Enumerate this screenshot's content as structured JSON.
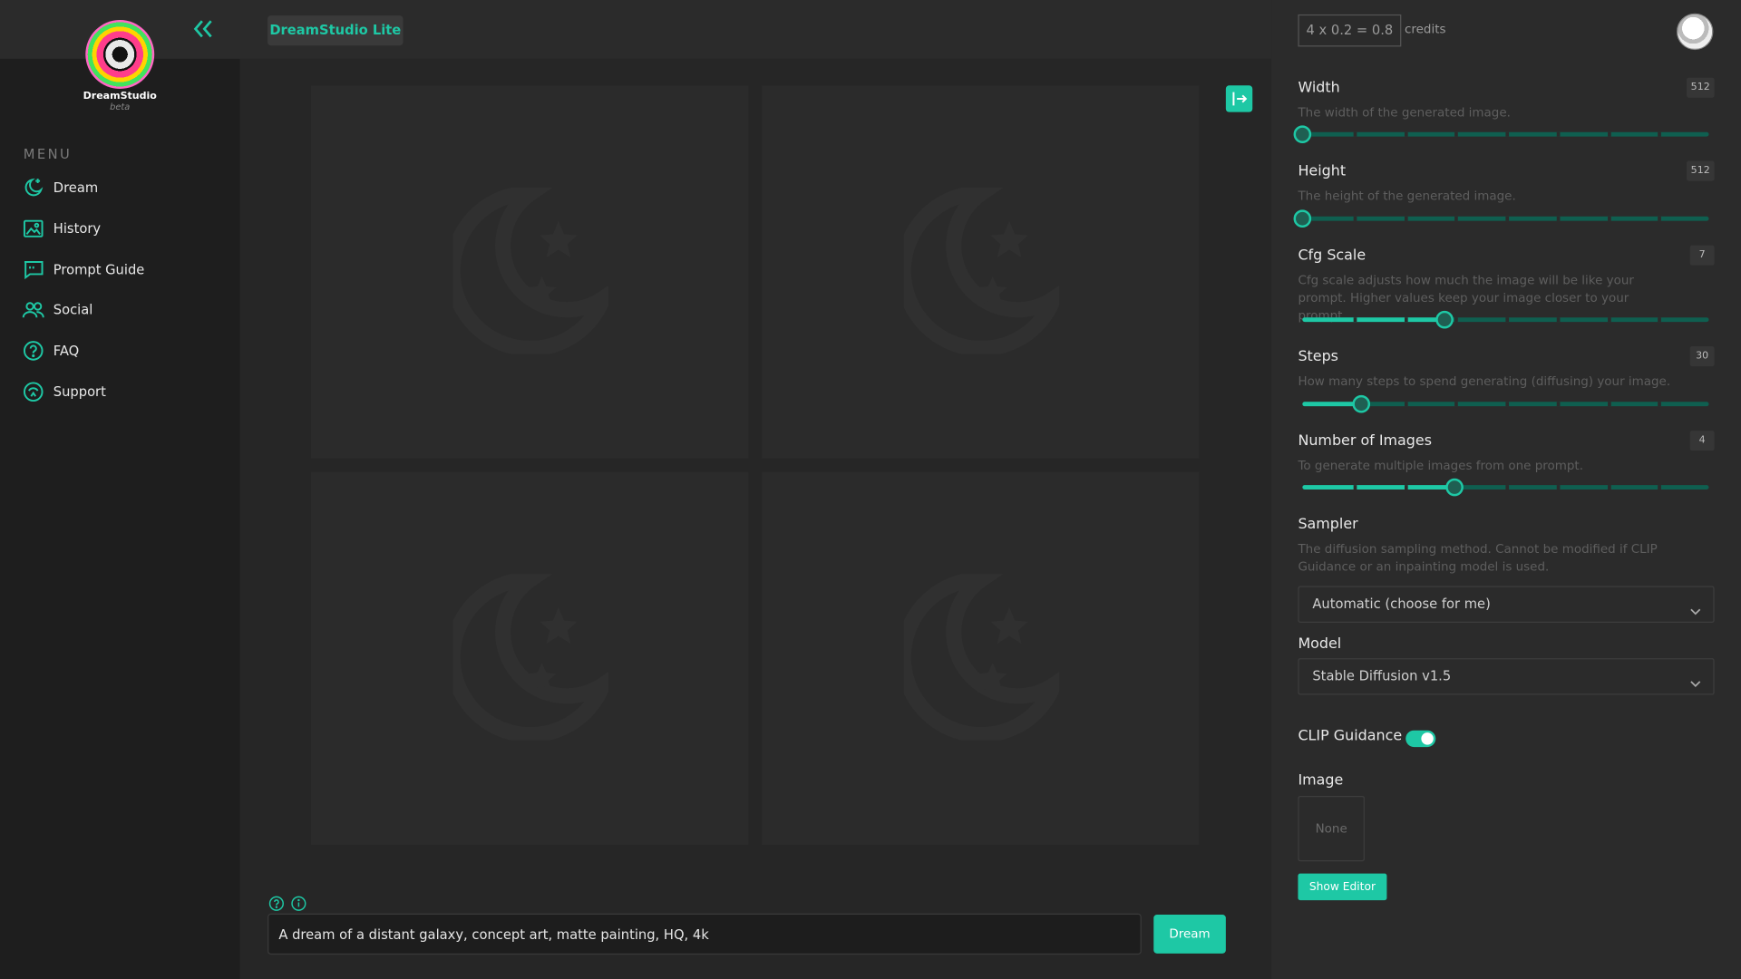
{
  "brand": {
    "app_name": "DreamStudio",
    "tag": "beta",
    "pill": "DreamStudio Lite"
  },
  "sidebar": {
    "menu_label": "MENU",
    "items": [
      {
        "label": "Dream",
        "icon": "moon-stars-icon"
      },
      {
        "label": "History",
        "icon": "image-icon"
      },
      {
        "label": "Prompt Guide",
        "icon": "quote-bubble-icon"
      },
      {
        "label": "Social",
        "icon": "users-icon"
      },
      {
        "label": "FAQ",
        "icon": "question-icon"
      },
      {
        "label": "Support",
        "icon": "support-icon"
      }
    ]
  },
  "prompt": {
    "value": "A dream of a distant galaxy, concept art, matte painting, HQ, 4k",
    "button": "Dream"
  },
  "credits": {
    "formula": "4 x 0.2 = 0.8",
    "label": "credits"
  },
  "settings": {
    "width": {
      "title": "Width",
      "value": "512",
      "desc": "The width of the generated image.",
      "fraction": 0.0
    },
    "height": {
      "title": "Height",
      "value": "512",
      "desc": "The height of the generated image.",
      "fraction": 0.0
    },
    "cfg": {
      "title": "Cfg Scale",
      "value": "7",
      "desc": "Cfg scale adjusts how much the image will be like your prompt. Higher values keep your image closer to your prompt.",
      "fraction": 0.35
    },
    "steps": {
      "title": "Steps",
      "value": "30",
      "desc": "How many steps to spend generating (diffusing) your image.",
      "fraction": 0.144
    },
    "images": {
      "title": "Number of Images",
      "value": "4",
      "desc": "To generate multiple images from one prompt.",
      "fraction": 0.375
    },
    "sampler": {
      "title": "Sampler",
      "desc": "The diffusion sampling method. Cannot be modified if CLIP Guidance or an inpainting model is used.",
      "selected": "Automatic (choose for me)"
    },
    "model": {
      "title": "Model",
      "selected": "Stable Diffusion v1.5"
    },
    "clip": {
      "title": "CLIP Guidance",
      "enabled": true
    },
    "image": {
      "title": "Image",
      "placeholder": "None",
      "editor_button": "Show Editor"
    }
  },
  "colors": {
    "accent": "#1ec8a5"
  }
}
